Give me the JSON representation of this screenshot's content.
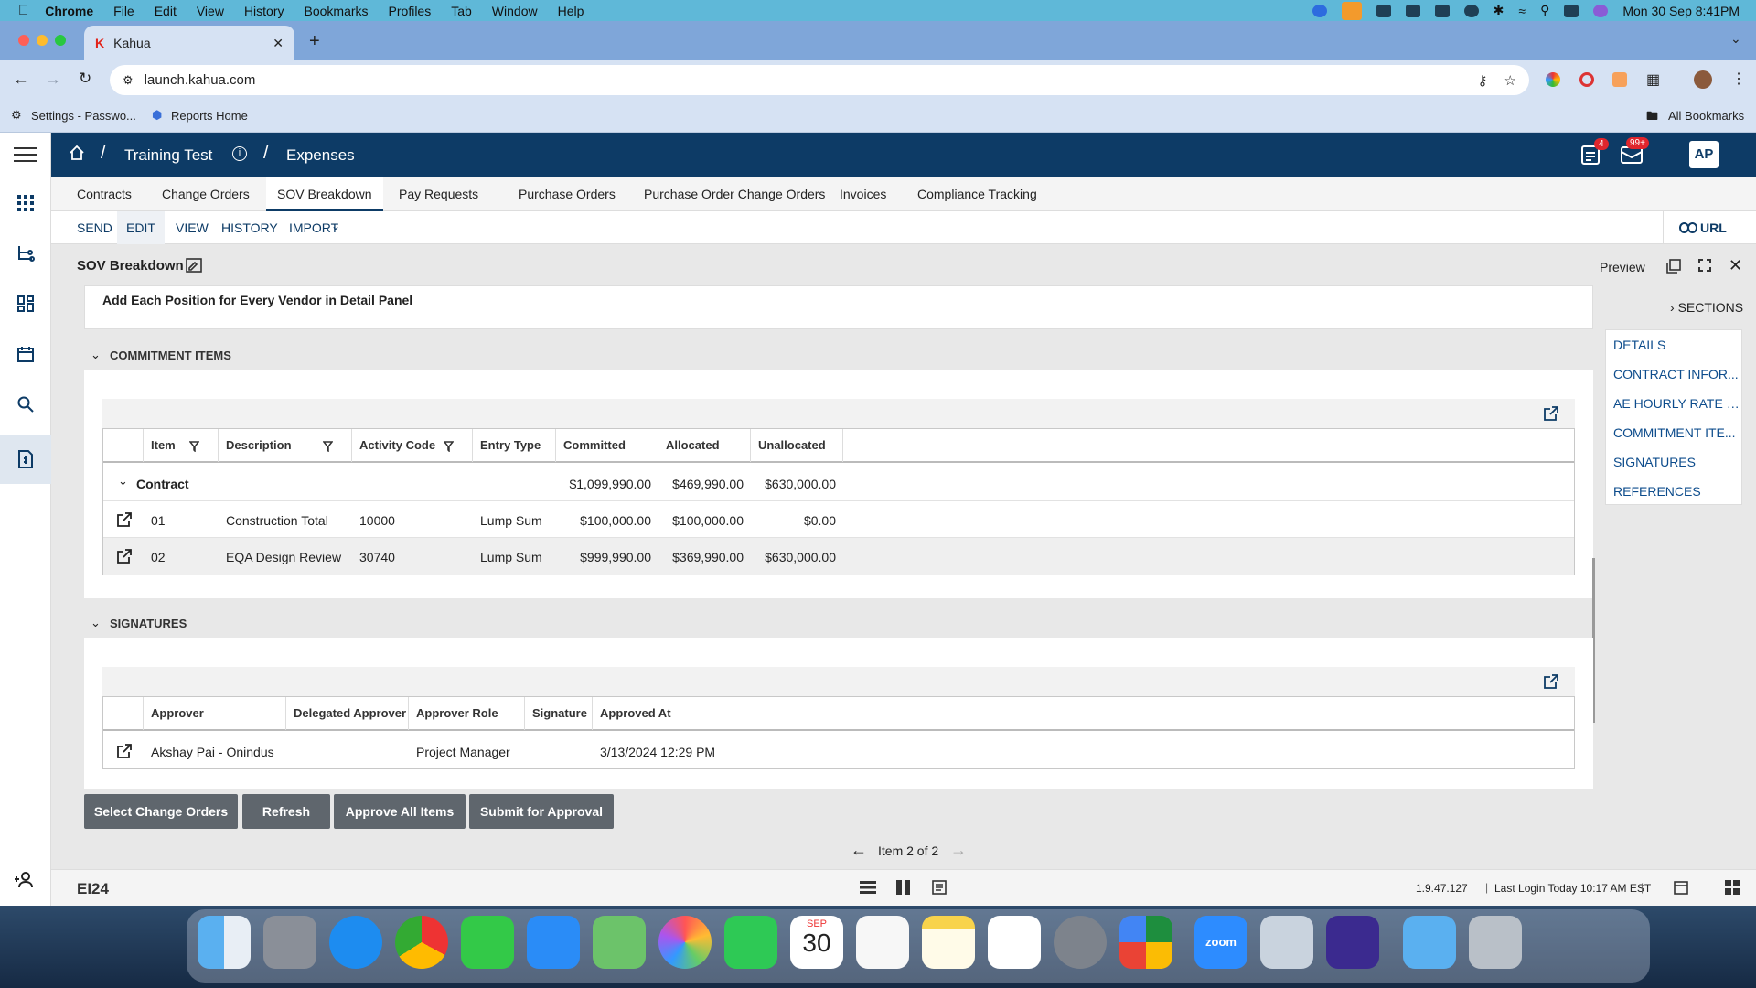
{
  "menubar": {
    "app": "Chrome",
    "items": [
      "File",
      "Edit",
      "View",
      "History",
      "Bookmarks",
      "Profiles",
      "Tab",
      "Window",
      "Help"
    ],
    "clock": "Mon 30 Sep  8:41PM"
  },
  "browser": {
    "tab_title": "Kahua",
    "url": "launch.kahua.com",
    "bookmarks": [
      "Settings - Passwo...",
      "Reports Home"
    ],
    "all_bookmarks": "All Bookmarks"
  },
  "app": {
    "breadcrumb_project": "Training Test",
    "breadcrumb_module": "Expenses",
    "notif_badge": "4",
    "mail_badge": "99+",
    "avatar": "AP"
  },
  "nav_tabs": [
    "Contracts",
    "Change Orders",
    "SOV Breakdown",
    "Pay Requests",
    "Purchase Orders",
    "Purchase Order Change Orders",
    "Invoices",
    "Compliance Tracking"
  ],
  "active_tab": "SOV Breakdown",
  "commands": [
    "SEND",
    "EDIT",
    "VIEW",
    "HISTORY",
    "IMPORT"
  ],
  "url_button": "URL",
  "doc": {
    "title": "SOV Breakdown",
    "preview": "Preview",
    "sections_toggle": "SECTIONS",
    "note": "Add Each Position for Every Vendor in Detail Panel"
  },
  "sections": [
    "DETAILS",
    "CONTRACT INFOR...",
    "AE HOURLY RATE S...",
    "COMMITMENT ITE...",
    "SIGNATURES",
    "REFERENCES"
  ],
  "commitment": {
    "header": "COMMITMENT ITEMS",
    "columns": [
      "Item",
      "Description",
      "Activity Code",
      "Entry Type",
      "Committed",
      "Allocated",
      "Unallocated"
    ],
    "group": {
      "label": "Contract",
      "committed": "$1,099,990.00",
      "allocated": "$469,990.00",
      "unallocated": "$630,000.00"
    },
    "rows": [
      {
        "item": "01",
        "description": "Construction Total",
        "activity": "10000",
        "entry": "Lump Sum",
        "committed": "$100,000.00",
        "allocated": "$100,000.00",
        "unallocated": "$0.00"
      },
      {
        "item": "02",
        "description": "EQA Design Review",
        "activity": "30740",
        "entry": "Lump Sum",
        "committed": "$999,990.00",
        "allocated": "$369,990.00",
        "unallocated": "$630,000.00"
      }
    ]
  },
  "signatures": {
    "header": "SIGNATURES",
    "columns": [
      "Approver",
      "Delegated Approver",
      "Approver Role",
      "Signature",
      "Approved At"
    ],
    "rows": [
      {
        "approver": "Akshay Pai - Onindus",
        "delegated": "",
        "role": "Project Manager",
        "signature": "",
        "approved_at": "3/13/2024 12:29 PM"
      }
    ]
  },
  "actions": [
    "Select Change Orders",
    "Refresh",
    "Approve All Items",
    "Submit for Approval"
  ],
  "pager": "Item 2 of 2",
  "footer": {
    "logo": "EI24",
    "version": "1.9.47.127",
    "last_login": "Last Login Today 10:17 AM EST"
  },
  "dock_calendar": {
    "month": "SEP",
    "day": "30"
  },
  "colors": {
    "primary": "#0d3b66",
    "link": "#0d4c8c",
    "button": "#5f666d"
  }
}
